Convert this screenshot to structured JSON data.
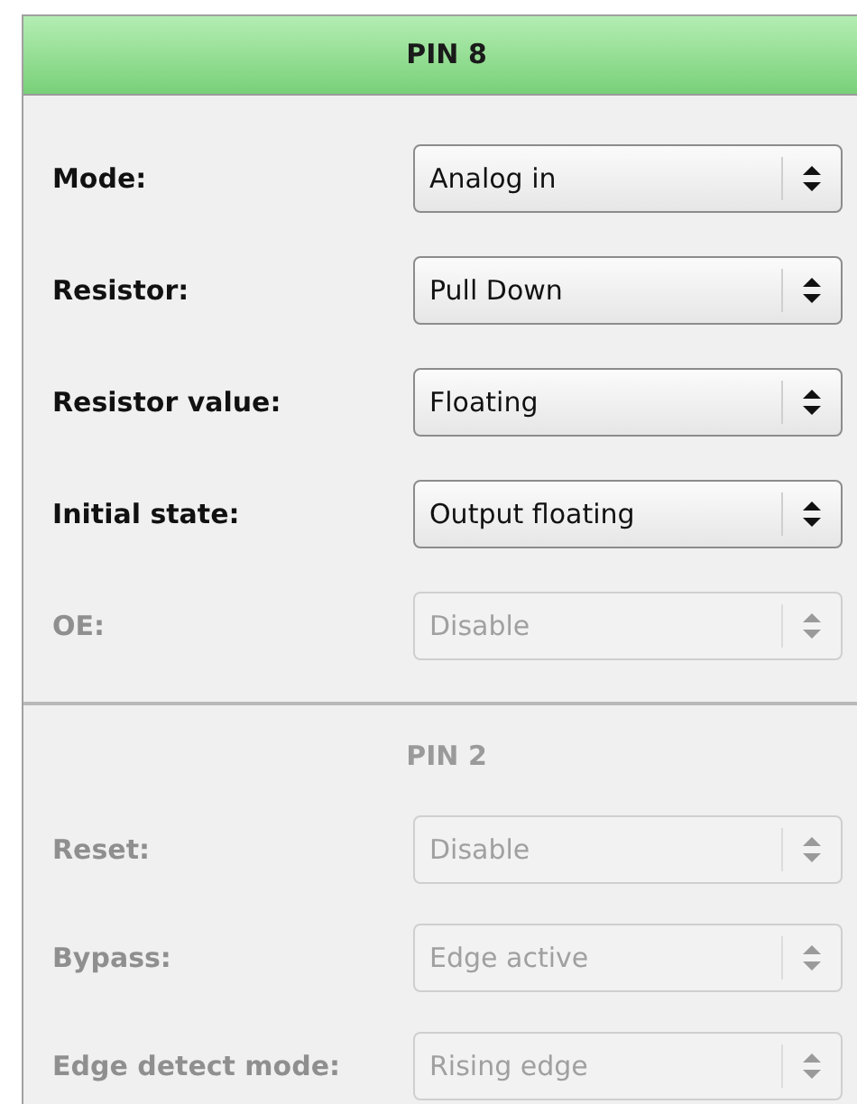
{
  "sections": [
    {
      "title": "PIN 8",
      "highlighted": true,
      "fields": [
        {
          "label": "Mode:",
          "value": "Analog in",
          "disabled": false
        },
        {
          "label": "Resistor:",
          "value": "Pull Down",
          "disabled": false
        },
        {
          "label": "Resistor value:",
          "value": "Floating",
          "disabled": false
        },
        {
          "label": "Initial state:",
          "value": "Output floating",
          "disabled": false
        },
        {
          "label": "OE:",
          "value": "Disable",
          "disabled": true
        }
      ]
    },
    {
      "title": "PIN 2",
      "highlighted": false,
      "fields": [
        {
          "label": "Reset:",
          "value": "Disable",
          "disabled": true
        },
        {
          "label": "Bypass:",
          "value": "Edge active",
          "disabled": true
        },
        {
          "label": "Edge detect mode:",
          "value": "Rising edge",
          "disabled": true
        }
      ]
    }
  ]
}
